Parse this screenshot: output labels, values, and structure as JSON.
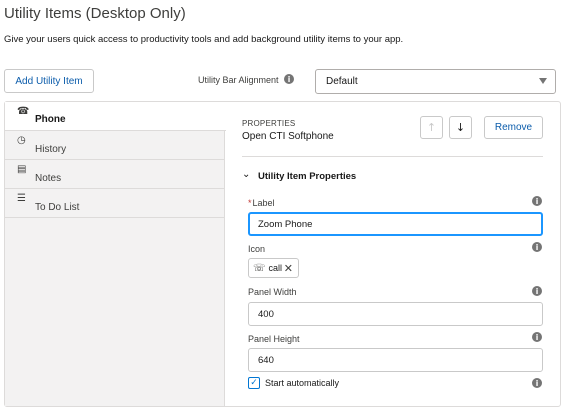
{
  "page": {
    "title": "Utility Items (Desktop Only)",
    "description": "Give your users quick access to productivity tools and add background utility items to your app."
  },
  "toolbar": {
    "add_label": "Add Utility Item",
    "alignment_label": "Utility Bar Alignment",
    "alignment_value": "Default"
  },
  "nav": {
    "items": [
      {
        "label": "Phone",
        "icon": "phone-icon",
        "glyph": "☎"
      },
      {
        "label": "History",
        "icon": "clock-icon",
        "glyph": "◷"
      },
      {
        "label": "Notes",
        "icon": "note-icon",
        "glyph": "▤"
      },
      {
        "label": "To Do List",
        "icon": "task-list-icon",
        "glyph": "☰"
      }
    ]
  },
  "properties": {
    "kicker": "PROPERTIES",
    "title": "Open CTI Softphone",
    "remove_label": "Remove",
    "section_title": "Utility Item Properties",
    "label_field": {
      "label": "Label",
      "required_mark": "*",
      "value": "Zoom Phone"
    },
    "icon_field": {
      "label": "Icon",
      "value": "call"
    },
    "panel_width": {
      "label": "Panel Width",
      "value": "400"
    },
    "panel_height": {
      "label": "Panel Height",
      "value": "640"
    },
    "start_auto": {
      "label": "Start automatically",
      "checked": true
    }
  },
  "colors": {
    "accent": "#0176d3",
    "focus_border": "#1b96ff",
    "link": "#0b5cab",
    "panel_bg": "#f3f2f2"
  }
}
